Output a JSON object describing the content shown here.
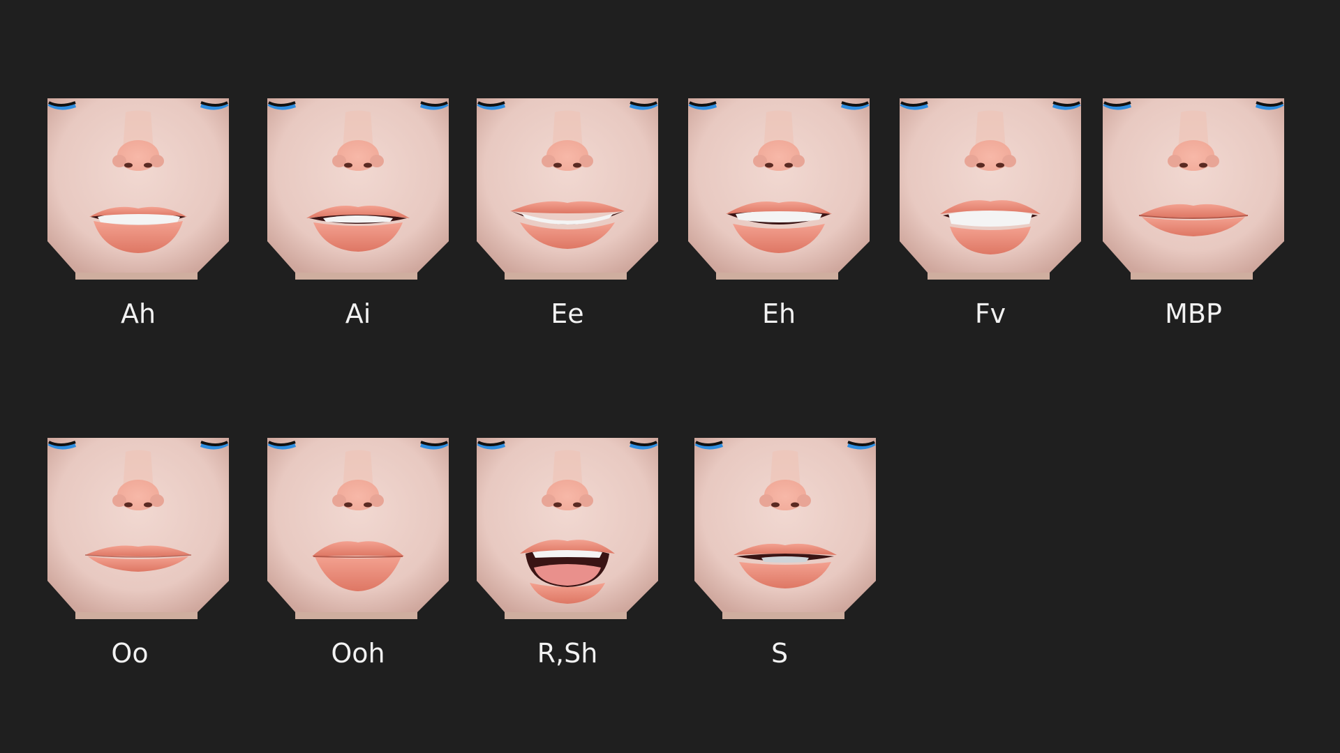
{
  "colors": {
    "background": "#1f1f1f",
    "label": "#f2f2f2",
    "skin": "#e8c9c1",
    "skin_shadow": "#cfa79d",
    "nose": "#f0a998",
    "lip": "#f08f7a",
    "lip_dark": "#de7764",
    "teeth": "#f4f4f4",
    "mouth_inner": "#3a1414",
    "tongue": "#e9908c",
    "eye_rim": "#2f8ee0"
  },
  "visemes": [
    {
      "label": "Ah",
      "shape": "ah"
    },
    {
      "label": "Ai",
      "shape": "ai"
    },
    {
      "label": "Ee",
      "shape": "ee"
    },
    {
      "label": "Eh",
      "shape": "eh"
    },
    {
      "label": "Fv",
      "shape": "fv"
    },
    {
      "label": "MBP",
      "shape": "mbp"
    },
    {
      "label": "Oo",
      "shape": "oo"
    },
    {
      "label": "Ooh",
      "shape": "ooh"
    },
    {
      "label": "R,Sh",
      "shape": "rsh"
    },
    {
      "label": "S",
      "shape": "s"
    }
  ]
}
